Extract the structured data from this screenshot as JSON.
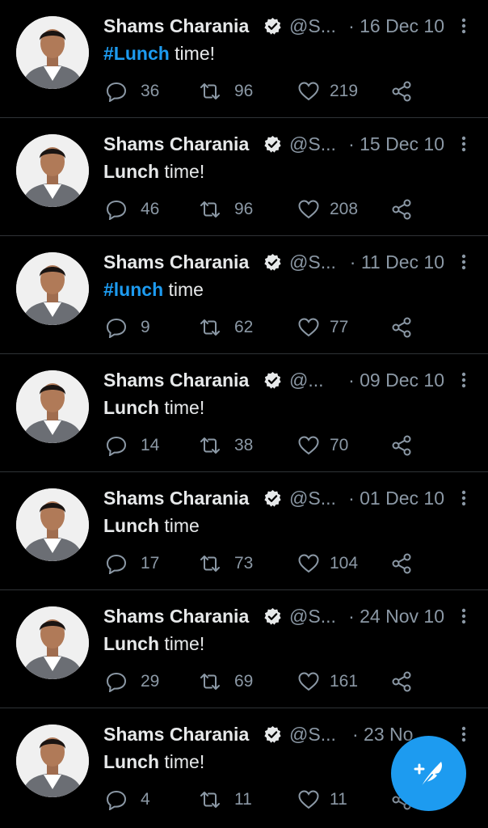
{
  "author": {
    "name": "Shams Charania",
    "verified": true
  },
  "colors": {
    "background": "#000000",
    "text": "#e7e9ea",
    "muted": "#8b98a5",
    "accent": "#1d9bf0"
  },
  "tweets": [
    {
      "handle": "@S...",
      "date": "· 16 Dec 10",
      "lead": "#Lunch",
      "rest": " time!",
      "lead_is_hashtag": true,
      "replies": "36",
      "retweets": "96",
      "likes": "219"
    },
    {
      "handle": "@S...",
      "date": "· 15 Dec 10",
      "lead": "Lunch",
      "rest": " time!",
      "lead_is_hashtag": false,
      "replies": "46",
      "retweets": "96",
      "likes": "208"
    },
    {
      "handle": "@S...",
      "date": "· 11 Dec 10",
      "lead": "#lunch",
      "rest": " time",
      "lead_is_hashtag": true,
      "replies": "9",
      "retweets": "62",
      "likes": "77"
    },
    {
      "handle": "@...",
      "date": "· 09 Dec 10",
      "lead": "Lunch",
      "rest": " time!",
      "lead_is_hashtag": false,
      "replies": "14",
      "retweets": "38",
      "likes": "70"
    },
    {
      "handle": "@S...",
      "date": "· 01 Dec 10",
      "lead": "Lunch",
      "rest": " time",
      "lead_is_hashtag": false,
      "replies": "17",
      "retweets": "73",
      "likes": "104"
    },
    {
      "handle": "@S...",
      "date": "· 24 Nov 10",
      "lead": "Lunch",
      "rest": " time!",
      "lead_is_hashtag": false,
      "replies": "29",
      "retweets": "69",
      "likes": "161"
    },
    {
      "handle": "@S...",
      "date": "· 23 No",
      "lead": "Lunch",
      "rest": " time!",
      "lead_is_hashtag": false,
      "replies": "4",
      "retweets": "11",
      "likes": "11"
    }
  ],
  "icons": {
    "avatar": "profile-photo",
    "verified": "verified-badge-icon",
    "more": "more-options-icon",
    "reply": "reply-icon",
    "retweet": "retweet-icon",
    "like": "heart-icon",
    "share": "share-icon",
    "compose": "compose-tweet-icon"
  }
}
